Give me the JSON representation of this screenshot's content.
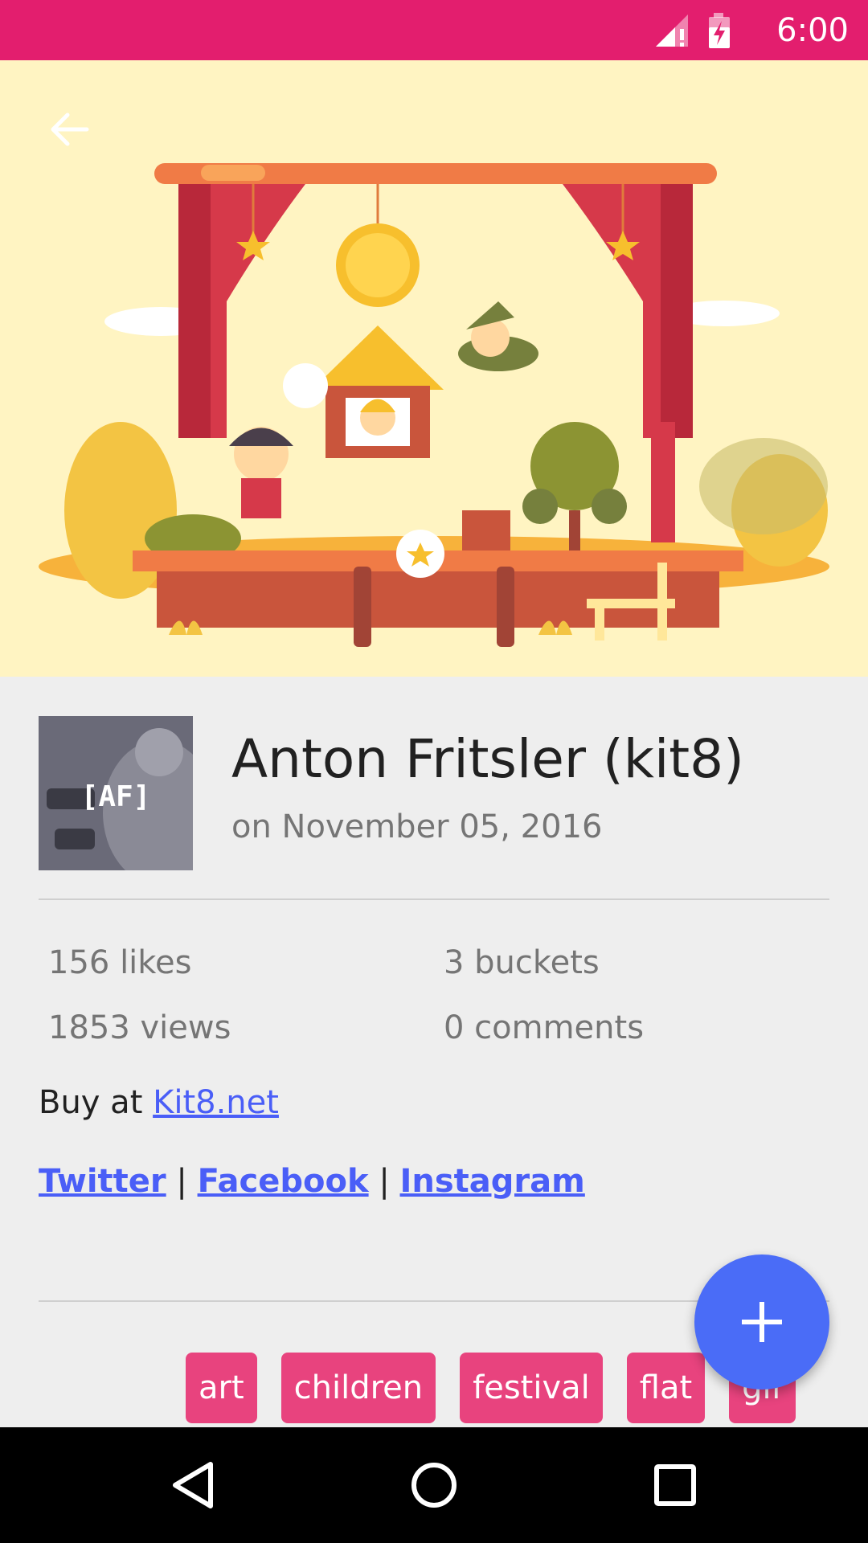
{
  "status_bar": {
    "time": "6:00",
    "icons": [
      "signal-icon",
      "battery-charging-icon"
    ],
    "background": "#e31e6e"
  },
  "hero": {
    "background": "#fff4c2",
    "back_icon": "arrow-back-icon"
  },
  "author": {
    "name": "Anton Fritsler (kit8)",
    "date": "on November 05, 2016",
    "avatar_mark": "[AF]"
  },
  "stats": {
    "likes": "156 likes",
    "buckets": "3 buckets",
    "views": "1853 views",
    "comments": "0 comments"
  },
  "description": {
    "buy_prefix": "Buy at ",
    "buy_link": "Kit8.net",
    "social_links": [
      "Twitter",
      "Facebook",
      "Instagram"
    ],
    "separator": "|"
  },
  "tags": [
    "art",
    "children",
    "festival",
    "flat",
    "gif"
  ],
  "fab": {
    "icon": "plus-icon",
    "color": "#4a6cf7"
  },
  "nav_bar": {
    "icons": [
      "back-triangle-icon",
      "home-circle-icon",
      "recents-square-icon"
    ]
  },
  "colors": {
    "accent": "#e31e6e",
    "link": "#4a5ef7",
    "tag": "#e8437e"
  }
}
